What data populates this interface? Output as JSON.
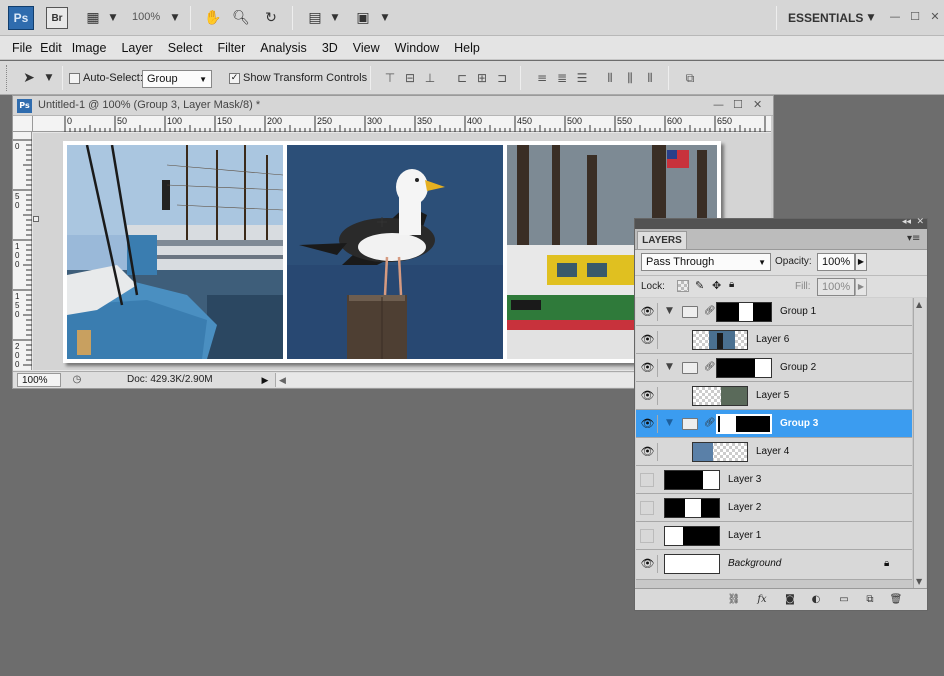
{
  "appbar": {
    "ps_logo": "Ps",
    "br_logo": "Br",
    "zoom": "100%",
    "workspace": "ESSENTIALS"
  },
  "menu": [
    "File",
    "Edit",
    "Image",
    "Layer",
    "Select",
    "Filter",
    "Analysis",
    "3D",
    "View",
    "Window",
    "Help"
  ],
  "options": {
    "auto_select_label": "Auto-Select:",
    "auto_select_checked": false,
    "auto_select_value": "Group",
    "transform_label": "Show Transform Controls",
    "transform_checked": true
  },
  "document": {
    "title": "Untitled-1 @ 100% (Group 3, Layer Mask/8) *",
    "ruler_h": [
      "0",
      "50",
      "100",
      "150",
      "200",
      "250",
      "300",
      "350",
      "400",
      "450",
      "500",
      "550",
      "600",
      "650"
    ],
    "ruler_v": [
      "0",
      "5 0",
      "1 0 0",
      "1 5 0",
      "2 0 0"
    ],
    "zoom": "100%",
    "doc_size": "Doc: 429.3K/2.90M"
  },
  "layers_panel": {
    "tab": "LAYERS",
    "blend_mode": "Pass Through",
    "opacity_label": "Opacity:",
    "opacity": "100%",
    "lock_label": "Lock:",
    "fill_label": "Fill:",
    "fill": "100%",
    "layers": [
      {
        "name": "Group 1",
        "type": "group",
        "visible": true,
        "selected": false
      },
      {
        "name": "Layer 6",
        "type": "layer",
        "visible": true,
        "selected": false
      },
      {
        "name": "Group 2",
        "type": "group",
        "visible": true,
        "selected": false
      },
      {
        "name": "Layer 5",
        "type": "layer",
        "visible": true,
        "selected": false
      },
      {
        "name": "Group 3",
        "type": "group",
        "visible": true,
        "selected": true
      },
      {
        "name": "Layer 4",
        "type": "layer",
        "visible": true,
        "selected": false
      },
      {
        "name": "Layer 3",
        "type": "mask",
        "visible": false,
        "selected": false
      },
      {
        "name": "Layer 2",
        "type": "mask",
        "visible": false,
        "selected": false
      },
      {
        "name": "Layer 1",
        "type": "mask",
        "visible": false,
        "selected": false
      },
      {
        "name": "Background",
        "type": "background",
        "visible": true,
        "selected": false
      }
    ]
  },
  "colors": {
    "selection": "#3b9cf0",
    "ps_brand": "#2f6cae"
  }
}
